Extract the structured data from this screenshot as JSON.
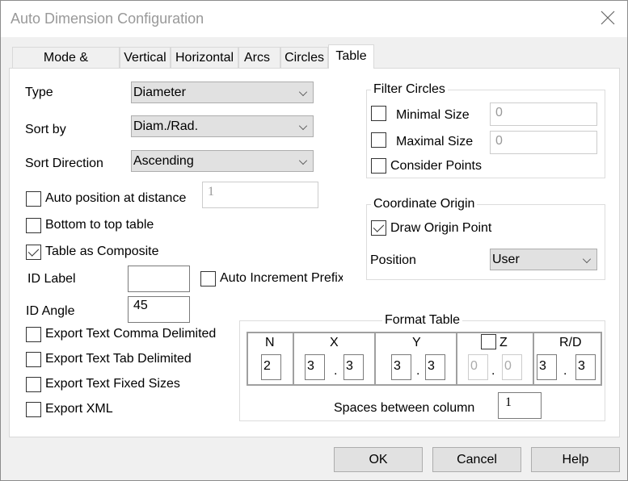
{
  "window": {
    "title": "Auto Dimension Configuration",
    "close_icon": "close-x-icon"
  },
  "tabs": [
    {
      "label": "Mode & Selection",
      "active": false
    },
    {
      "label": "Vertical",
      "active": false
    },
    {
      "label": "Horizontal",
      "active": false
    },
    {
      "label": "Arcs",
      "active": false
    },
    {
      "label": "Circles",
      "active": false
    },
    {
      "label": "Table",
      "active": true
    }
  ],
  "left": {
    "type": {
      "label": "Type",
      "value": "Diameter"
    },
    "sort_by": {
      "label": "Sort by",
      "value": "Diam./Rad."
    },
    "sort_direction": {
      "label": "Sort Direction",
      "value": "Ascending"
    },
    "auto_position": {
      "label": "Auto position at distance",
      "checked": false,
      "value": "1"
    },
    "bottom_to_top": {
      "label": "Bottom to top table",
      "checked": false
    },
    "table_composite": {
      "label": "Table as Composite",
      "checked": true
    },
    "id_label": {
      "label": "ID Label",
      "value": ""
    },
    "auto_increment": {
      "label": "Auto Increment Prefix",
      "checked": false
    },
    "id_angle": {
      "label": "ID Angle",
      "value": "45"
    },
    "export_comma": {
      "label": "Export Text Comma Delimited",
      "checked": false
    },
    "export_tab": {
      "label": "Export Text Tab Delimited",
      "checked": false
    },
    "export_fixed": {
      "label": "Export Text Fixed Sizes",
      "checked": false
    },
    "export_xml": {
      "label": "Export XML",
      "checked": false
    }
  },
  "filter_circles": {
    "title": "Filter Circles",
    "minimal": {
      "label": "Minimal Size",
      "checked": false,
      "value": "0"
    },
    "maximal": {
      "label": "Maximal Size",
      "checked": false,
      "value": "0"
    },
    "consider_points": {
      "label": "Consider Points",
      "checked": false
    }
  },
  "coordinate_origin": {
    "title": "Coordinate Origin",
    "draw_origin": {
      "label": "Draw Origin Point",
      "checked": true
    },
    "position": {
      "label": "Position",
      "value": "User"
    }
  },
  "format_table": {
    "title": "Format Table",
    "n": {
      "label": "N",
      "value": "2"
    },
    "x": {
      "label": "X",
      "int": "3",
      "dec": "3"
    },
    "y": {
      "label": "Y",
      "int": "3",
      "dec": "3"
    },
    "z": {
      "label": "Z",
      "checked": false,
      "int": "0",
      "dec": "0"
    },
    "rd": {
      "label": "R/D",
      "int": "3",
      "dec": "3"
    },
    "separator": ".",
    "spaces": {
      "label": "Spaces between column",
      "value": "1"
    }
  },
  "buttons": {
    "ok": "OK",
    "cancel": "Cancel",
    "help": "Help"
  }
}
